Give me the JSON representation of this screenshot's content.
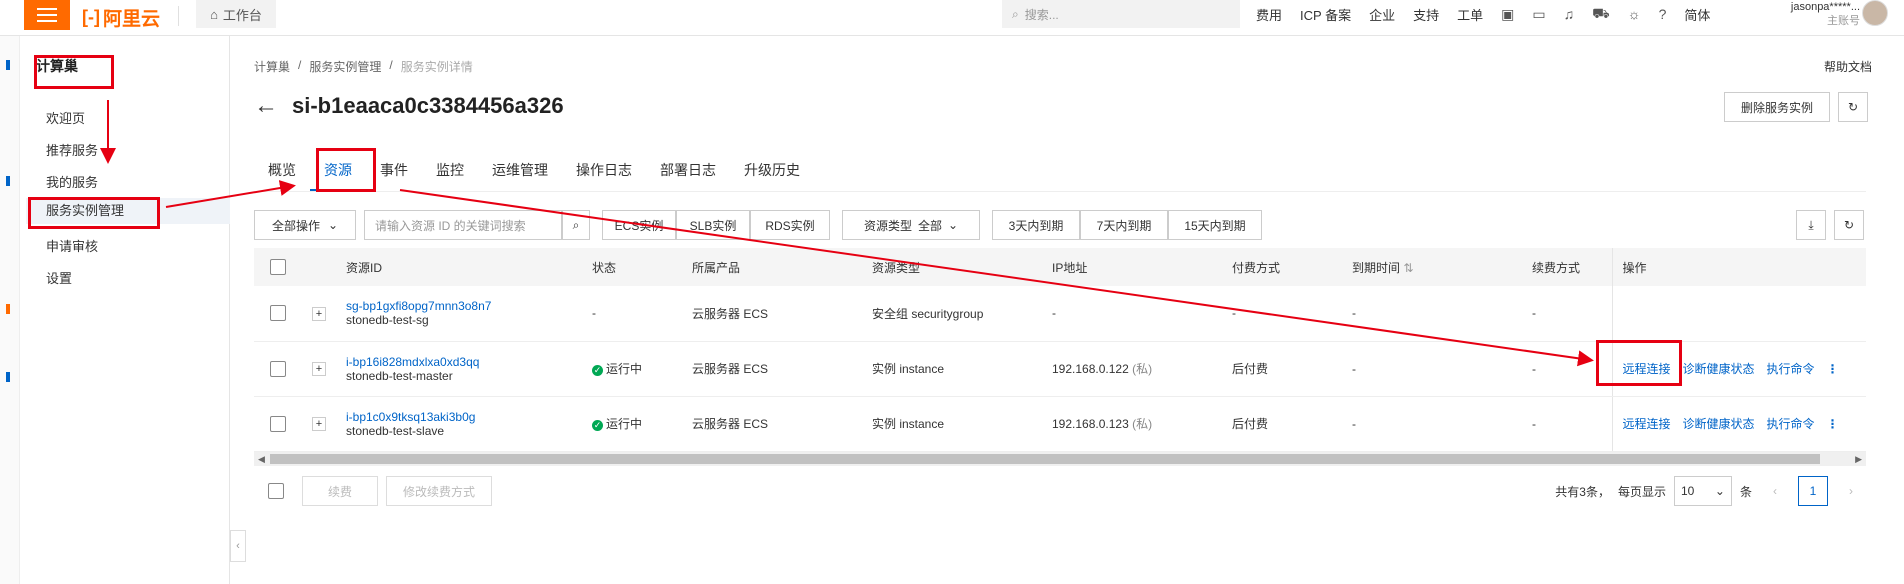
{
  "topbar": {
    "logo_text": "阿里云",
    "workbench_label": "工作台",
    "search_placeholder": "搜索...",
    "nav": [
      "费用",
      "ICP 备案",
      "企业",
      "支持",
      "工单"
    ],
    "lang_label": "简体",
    "user_name": "jasonpa*****...",
    "user_role": "主账号",
    "brand_color": "#ff6a00"
  },
  "sidebar": {
    "title": "计算巢",
    "items": [
      {
        "label": "欢迎页"
      },
      {
        "label": "推荐服务"
      },
      {
        "label": "我的服务"
      },
      {
        "label": "服务实例管理"
      },
      {
        "label": "申请审核"
      },
      {
        "label": "设置"
      }
    ],
    "active_index": 3
  },
  "breadcrumb": [
    "计算巢",
    "服务实例管理",
    "服务实例详情"
  ],
  "help_link": "帮助文档",
  "page_title": "si-b1eaaca0c3384456a326",
  "delete_button": "删除服务实例",
  "tabs": [
    "概览",
    "资源",
    "事件",
    "监控",
    "运维管理",
    "操作日志",
    "部署日志",
    "升级历史"
  ],
  "active_tab": 1,
  "filters": {
    "all_ops": "全部操作",
    "search_placeholder": "请输入资源 ID 的关键词搜索",
    "type_buttons": [
      "ECS实例",
      "SLB实例",
      "RDS实例"
    ],
    "resource_type_label": "资源类型",
    "resource_type_value": "全部",
    "expiry_buttons": [
      "3天内到期",
      "7天内到期",
      "15天内到期"
    ]
  },
  "table": {
    "headers": [
      "资源ID",
      "状态",
      "所属产品",
      "资源类型",
      "IP地址",
      "付费方式",
      "到期时间",
      "续费方式",
      "操作"
    ],
    "rows": [
      {
        "id": "sg-bp1gxfi8opg7mnn3o8n7",
        "name": "stonedb-test-sg",
        "status": "-",
        "product": "云服务器 ECS",
        "type": "安全组 securitygroup",
        "ip": "-",
        "ip_tag": "",
        "billing": "-",
        "expire": "-",
        "renew": "-",
        "ops": []
      },
      {
        "id": "i-bp16i828mdxlxa0xd3qq",
        "name": "stonedb-test-master",
        "status": "运行中",
        "product": "云服务器 ECS",
        "type": "实例 instance",
        "ip": "192.168.0.122",
        "ip_tag": "(私)",
        "billing": "后付费",
        "expire": "-",
        "renew": "-",
        "ops": [
          "远程连接",
          "诊断健康状态",
          "执行命令"
        ]
      },
      {
        "id": "i-bp1c0x9tksq13aki3b0g",
        "name": "stonedb-test-slave",
        "status": "运行中",
        "product": "云服务器 ECS",
        "type": "实例 instance",
        "ip": "192.168.0.123",
        "ip_tag": "(私)",
        "billing": "后付费",
        "expire": "-",
        "renew": "-",
        "ops": [
          "远程连接",
          "诊断健康状态",
          "执行命令"
        ]
      }
    ]
  },
  "footer": {
    "renew_button": "续费",
    "modify_renew_button": "修改续费方式",
    "total_text": "共有3条，",
    "page_size_label": "每页显示",
    "page_size": "10",
    "unit": "条",
    "current_page": "1"
  },
  "annotation_color": "#e60012"
}
